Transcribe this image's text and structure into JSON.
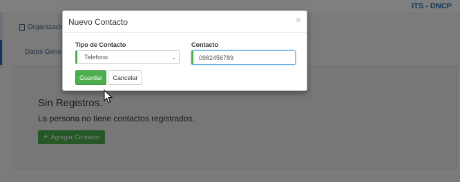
{
  "app": {
    "brand": "ITS - DNCP"
  },
  "tabs": {
    "organizaciones": "Organizacio",
    "datos_generales": "Datos Genera"
  },
  "empty_state": {
    "title": "Sin Registros.",
    "message": "La persona no tiene contactos registrados.",
    "add_button": "Agregar Contacto",
    "add_icon": "plus-icon"
  },
  "modal": {
    "title": "Nuevo Contacto",
    "close_glyph": "×",
    "tipo_label": "Tipo de Contacto",
    "tipo_value": "Telefono",
    "contacto_label": "Contacto",
    "contacto_value": "0982456789",
    "save_label": "Guardar",
    "cancel_label": "Cancelar"
  },
  "colors": {
    "primary_green": "#4cae4c",
    "brand_blue": "#2a6db0",
    "focus_blue": "#66afe9"
  }
}
